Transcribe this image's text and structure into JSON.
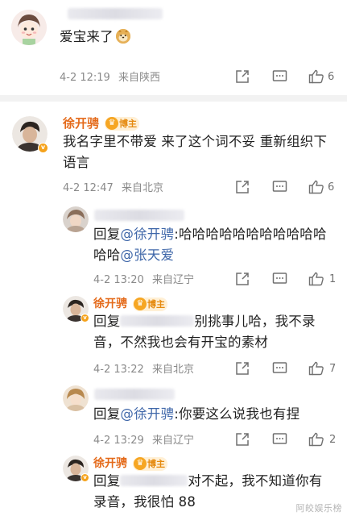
{
  "comments": [
    {
      "text": "爱宝来了",
      "emoji_icon": "doge-emoji-icon",
      "time": "4-2 12:19",
      "location": "来自陕西",
      "likes": "6"
    },
    {
      "author": "徐开骋",
      "badge": "博主",
      "text": "我名字里不带爱 来了这个词不妥 重新组织下语言",
      "time": "4-2 12:47",
      "location": "来自北京",
      "likes": "6"
    }
  ],
  "replies": [
    {
      "prefix": "回复",
      "mention1": "@徐开骋",
      "text_a": ":哈哈哈哈哈哈哈哈哈哈哈哈哈",
      "mention2": "@张天爱",
      "time": "4-2 13:20",
      "location": "来自辽宁",
      "likes": "1"
    },
    {
      "author": "徐开骋",
      "badge": "博主",
      "prefix": "回复",
      "text": "别挑事儿哈，我不录音，不然我也会有开宝的素材",
      "time": "4-2 13:22",
      "location": "来自北京",
      "likes": "7"
    },
    {
      "prefix": "回复",
      "mention": "@徐开骋",
      "text": ":你要这么说我也有捏",
      "time": "4-2 13:29",
      "location": "来自辽宁",
      "likes": "2"
    },
    {
      "author": "徐开骋",
      "badge": "博主",
      "prefix": "回复",
      "text": "对不起，我不知道你有录音，我很怕 88"
    }
  ],
  "watermark": "阿皎娱乐榜",
  "icons": [
    "share-icon",
    "comment-icon",
    "like-icon"
  ],
  "colors": {
    "name": "#e46a1a",
    "link": "#3f67a9",
    "meta": "#8a8a8a",
    "badge_bg": "#fff0d6"
  }
}
